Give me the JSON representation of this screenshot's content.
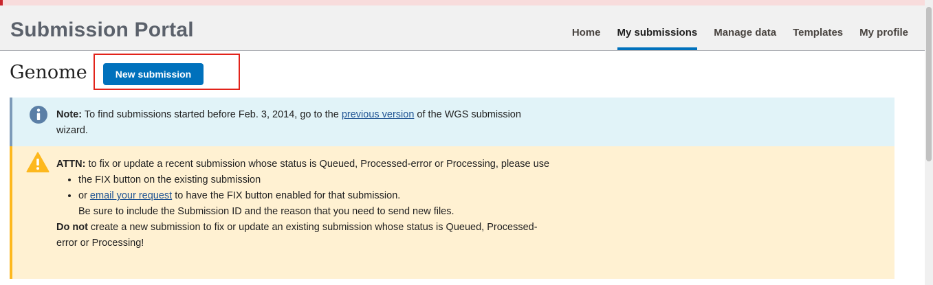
{
  "header": {
    "title": "Submission Portal",
    "nav": [
      {
        "label": "Home"
      },
      {
        "label": "My submissions",
        "active": true
      },
      {
        "label": "Manage data"
      },
      {
        "label": "Templates"
      },
      {
        "label": "My profile"
      }
    ]
  },
  "page": {
    "heading": "Genome",
    "new_submission_label": "New submission"
  },
  "note": {
    "icon": "info-icon",
    "label": "Note:",
    "text_before": " To find submissions started before Feb. 3, 2014, go to the ",
    "link": "previous version",
    "text_after": " of the WGS submission wizard."
  },
  "attn": {
    "icon": "warning-icon",
    "label": "ATTN:",
    "intro": " to fix or update a recent submission whose status is Queued, Processed-error or Processing, please use",
    "item1": "the FIX button on the existing submission",
    "item2_prefix": "or ",
    "item2_link": "email your request",
    "item2_suffix": " to have the FIX button enabled for that submission.",
    "item2_subline": "Be sure to include the Submission ID and the reason that you need to send new files.",
    "warning_bold": "Do not",
    "warning_text": " create a new submission to fix or update an existing submission whose status is Queued, Processed-error or Processing!"
  },
  "colors": {
    "primary": "#0071bc",
    "note_bg": "#e1f3f8",
    "attn_bg": "#fff1d2",
    "attn_accent": "#fdb81e",
    "highlight": "#e2231a"
  }
}
